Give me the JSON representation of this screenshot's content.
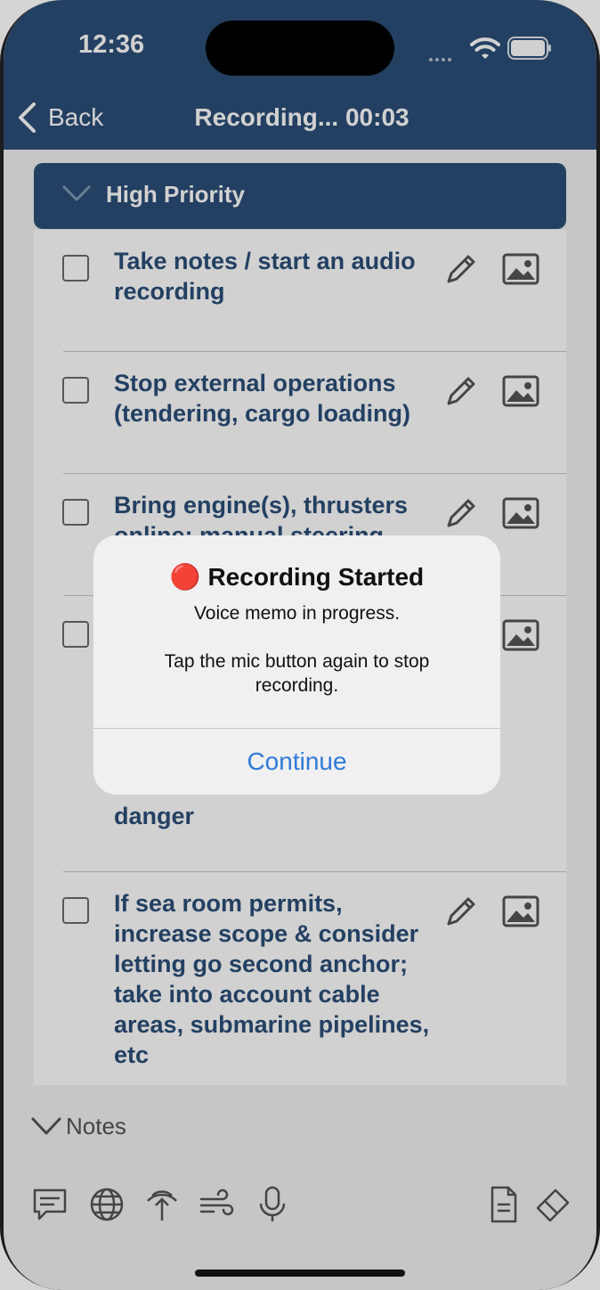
{
  "status_bar": {
    "time": "12:36"
  },
  "nav": {
    "back_label": "Back",
    "title": "Recording... 00:03"
  },
  "section": {
    "title": "High Priority"
  },
  "items": [
    {
      "text": "Take notes / start an audio recording"
    },
    {
      "text": "Stop external operations (tendering, cargo loading)"
    },
    {
      "text": "Bring engine(s), thrusters online; manual steering"
    },
    {
      "text": "danger"
    },
    {
      "text": "If sea room permits, increase scope & consider letting go second anchor; take into account cable areas, submarine pipelines, etc"
    }
  ],
  "notes": {
    "label": "Notes"
  },
  "toolbar": {
    "icons": [
      "message-icon",
      "globe-icon",
      "radar-icon",
      "wind-icon",
      "mic-icon",
      "document-icon",
      "eraser-icon"
    ]
  },
  "alert": {
    "title": "🔴 Recording Started",
    "message": "Voice memo in progress.\n\nTap the mic button again to stop recording.",
    "button": "Continue"
  },
  "colors": {
    "header": "#2b4f78",
    "item_text": "#2b4f78",
    "alert_button": "#2f7ad8"
  }
}
